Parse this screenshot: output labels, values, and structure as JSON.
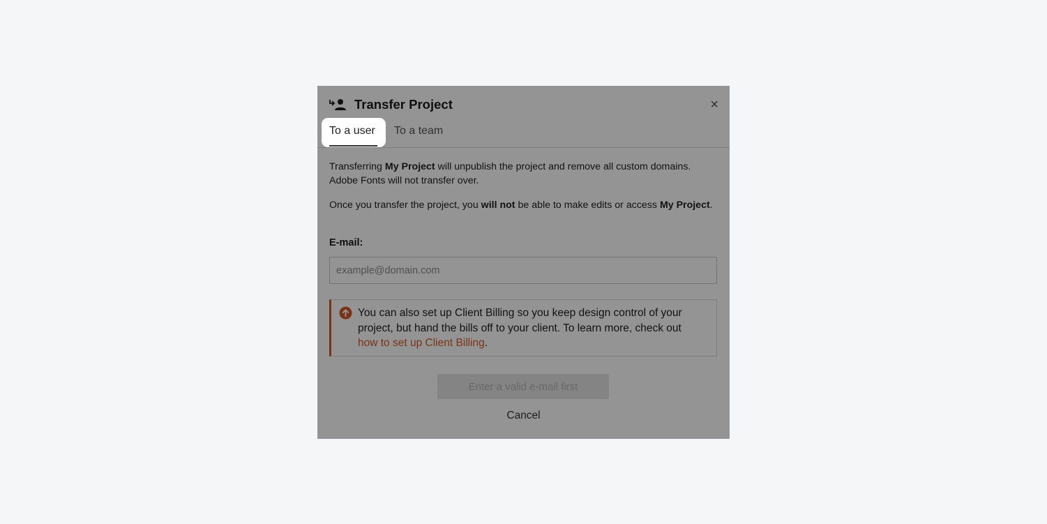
{
  "dialog": {
    "title": "Transfer Project",
    "close_glyph": "×",
    "icon": "transfer-user-icon"
  },
  "tabs": [
    {
      "label": "To a user",
      "active": true
    },
    {
      "label": "To a team",
      "active": false
    }
  ],
  "body": {
    "p1_a": "Transferring ",
    "p1_b": "My Project",
    "p1_c": " will unpublish the project and remove all custom domains. Adobe Fonts will not transfer over.",
    "p2_a": "Once you transfer the project, you ",
    "p2_b": "will not",
    "p2_c": " be able to make edits or access ",
    "p2_d": "My Project",
    "p2_e": "."
  },
  "email": {
    "label": "E-mail:",
    "placeholder": "example@domain.com",
    "value": ""
  },
  "notice": {
    "text": "You can also set up Client Billing so you keep design control of your project, but hand the bills off to your client. To learn more, check out ",
    "link": "how to set up Client Billing",
    "suffix": ".",
    "accent": "#d4582a",
    "icon": "arrow-up-circle-icon"
  },
  "actions": {
    "primary": "Enter a valid e-mail first",
    "cancel": "Cancel"
  }
}
